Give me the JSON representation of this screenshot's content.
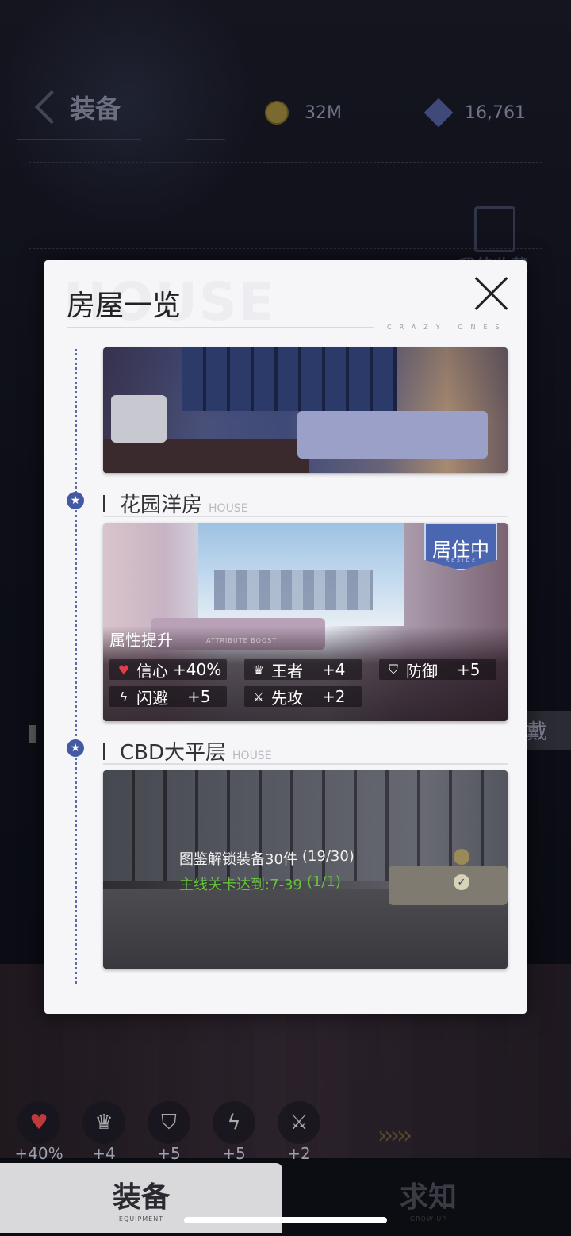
{
  "background": {
    "header": {
      "title": "装备",
      "title_sub": "EQUIPMENT"
    },
    "currency": {
      "gold": "32M",
      "gems": "16,761"
    },
    "collection_label": "我的收藏",
    "side_tab_label": "戴",
    "stats": [
      {
        "icon": "heart-icon",
        "value": "+40%"
      },
      {
        "icon": "crown-icon",
        "value": "+4"
      },
      {
        "icon": "shield-icon",
        "value": "+5"
      },
      {
        "icon": "lightning-icon",
        "value": "+5"
      },
      {
        "icon": "swords-icon",
        "value": "+2"
      }
    ],
    "nav": [
      {
        "label": "装备",
        "sub": "EQUIPMENT",
        "active": true
      },
      {
        "label": "求知",
        "sub": "GROW UP",
        "active": false
      }
    ]
  },
  "modal": {
    "title": "房屋一览",
    "watermark": "HOUSE",
    "brand": "CRAZY ONES",
    "houses": [
      {
        "name": "花园洋房",
        "sub": "HOUSE",
        "status_badge": "居住中",
        "status_badge_sub": "RESIDE",
        "attr_label": "属性提升",
        "attr_label_sub": "ATTRIBUTE BOOST",
        "attributes": [
          {
            "icon": "heart-icon",
            "name": "信心",
            "value": "+40%"
          },
          {
            "icon": "crown-icon",
            "name": "王者",
            "value": "+4"
          },
          {
            "icon": "shield-icon",
            "name": "防御",
            "value": "+5"
          },
          {
            "icon": "lightning-icon",
            "name": "闪避",
            "value": "+5"
          },
          {
            "icon": "swords-icon",
            "name": "先攻",
            "value": "+2"
          }
        ]
      },
      {
        "name": "CBD大平层",
        "sub": "HOUSE",
        "conditions": [
          {
            "text": "图鉴解锁装备30件",
            "progress": "(19/30)",
            "done": false
          },
          {
            "text": "主线关卡达到:7-39",
            "progress": "(1/1)",
            "done": true
          }
        ]
      }
    ]
  }
}
